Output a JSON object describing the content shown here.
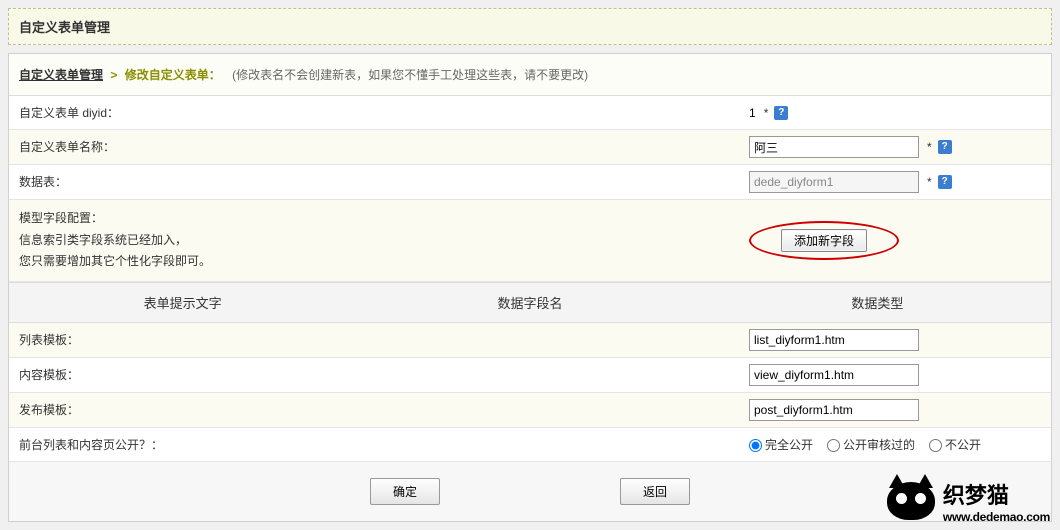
{
  "panel_title": "自定义表单管理",
  "breadcrumb": {
    "root": "自定义表单管理",
    "separator": ">",
    "current": "修改自定义表单：",
    "note": "(修改表名不会创建新表，如果您不懂手工处理这些表，请不要更改)"
  },
  "fields": {
    "diyid_label": "自定义表单 diyid：",
    "diyid_value": "1",
    "name_label": "自定义表单名称：",
    "name_value": "阿三",
    "table_label": "数据表：",
    "table_value": "dede_diyform1",
    "required_mark": "*"
  },
  "model_section": {
    "title": "模型字段配置：",
    "line1": "信息索引类字段系统已经加入，",
    "line2": "您只需要增加其它个性化字段即可。",
    "add_button": "添加新字段"
  },
  "table_headers": {
    "col1": "表单提示文字",
    "col2": "数据字段名",
    "col3": "数据类型"
  },
  "templates": {
    "list_label": "列表模板：",
    "list_value": "list_diyform1.htm",
    "view_label": "内容模板：",
    "view_value": "view_diyform1.htm",
    "post_label": "发布模板：",
    "post_value": "post_diyform1.htm"
  },
  "visibility": {
    "label": "前台列表和内容页公开？：",
    "opt1": "完全公开",
    "opt2": "公开审核过的",
    "opt3": "不公开"
  },
  "buttons": {
    "submit": "确定",
    "back": "返回"
  },
  "help_icon": "?",
  "footer": {
    "brand": "织梦猫",
    "url": "www.dedemao.com"
  }
}
